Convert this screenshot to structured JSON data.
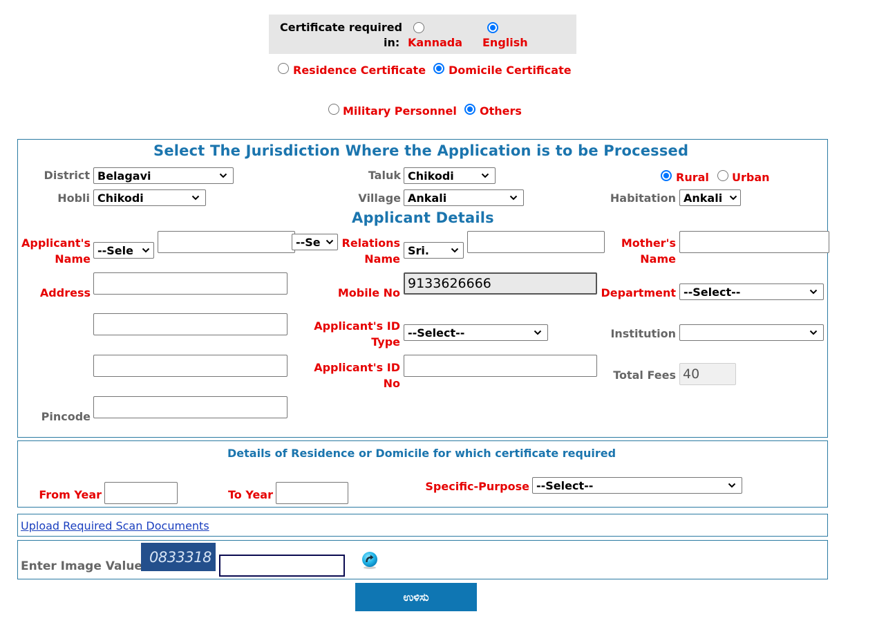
{
  "language_selector": {
    "label_line1": "Certificate required",
    "label_line2": "in:",
    "options": [
      {
        "label": "Kannada",
        "selected": false
      },
      {
        "label": "English",
        "selected": true
      }
    ]
  },
  "certificate_type": {
    "options": [
      {
        "label": "Residence Certificate",
        "selected": false
      },
      {
        "label": "Domicile Certificate",
        "selected": true
      }
    ]
  },
  "applicant_category": {
    "options": [
      {
        "label": "Military Personnel",
        "selected": false
      },
      {
        "label": "Others",
        "selected": true
      }
    ]
  },
  "jurisdiction": {
    "title": "Select The Jurisdiction Where the Application is to be Processed",
    "district": {
      "label": "District",
      "value": "Belagavi"
    },
    "taluk": {
      "label": "Taluk",
      "value": "Chikodi"
    },
    "area_type": {
      "options": [
        {
          "label": "Rural",
          "selected": true
        },
        {
          "label": "Urban",
          "selected": false
        }
      ]
    },
    "hobli": {
      "label": "Hobli",
      "value": "Chikodi"
    },
    "village": {
      "label": "Village",
      "value": "Ankali"
    },
    "habitation": {
      "label": "Habitation",
      "value": "Ankali"
    }
  },
  "applicant": {
    "title": "Applicant Details",
    "name": {
      "label_line1": "Applicant's",
      "label_line2": "Name",
      "salutation": "--Sele",
      "value": "",
      "suffix_select": "--Se"
    },
    "relation": {
      "label_line1": "Relations",
      "label_line2": "Name",
      "salutation": "Sri.",
      "value": ""
    },
    "mother": {
      "label_line1": "Mother's",
      "label_line2": "Name",
      "value": ""
    },
    "address": {
      "label": "Address",
      "line1": "",
      "line2": "",
      "line3": ""
    },
    "mobile": {
      "label": "Mobile No",
      "value": "9133626666"
    },
    "department": {
      "label": "Department",
      "value": "--Select--"
    },
    "id_type": {
      "label_line1": "Applicant's ID",
      "label_line2": "Type",
      "value": "--Select--"
    },
    "institution": {
      "label": "Institution",
      "value": ""
    },
    "id_no": {
      "label_line1": "Applicant's ID",
      "label_line2": "No",
      "value": ""
    },
    "total_fees": {
      "label": "Total Fees",
      "value": "40"
    },
    "pincode": {
      "label": "Pincode",
      "value": ""
    }
  },
  "residence_details": {
    "title": "Details of Residence or Domicile for which certificate required",
    "from_year": {
      "label": "From Year",
      "value": ""
    },
    "to_year": {
      "label": "To Year",
      "value": ""
    },
    "purpose": {
      "label": "Specific-Purpose",
      "value": "--Select--"
    }
  },
  "upload": {
    "link_label": "Upload Required Scan Documents"
  },
  "captcha": {
    "label": "Enter Image Value",
    "image_text": "0833318",
    "value": ""
  },
  "submit": {
    "label": "ಉಳಿಸು"
  },
  "colors": {
    "accent_blue": "#1b75ae",
    "label_red": "#e60000",
    "button_blue": "#0f76b3",
    "captcha_bg": "#234f8c"
  }
}
